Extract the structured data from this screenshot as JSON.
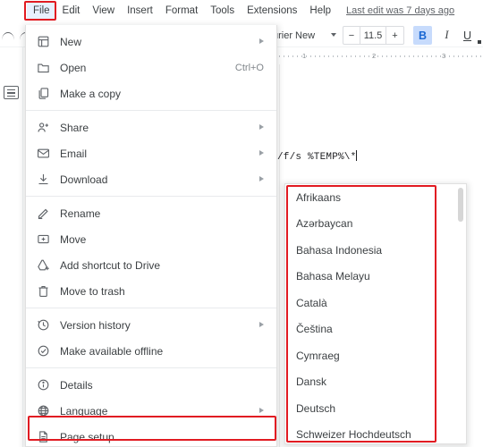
{
  "app": {
    "logo_icon": "google-docs-logo"
  },
  "menubar": {
    "items": [
      {
        "label": "File",
        "active": true
      },
      {
        "label": "Edit",
        "active": false
      },
      {
        "label": "View",
        "active": false
      },
      {
        "label": "Insert",
        "active": false
      },
      {
        "label": "Format",
        "active": false
      },
      {
        "label": "Tools",
        "active": false
      },
      {
        "label": "Extensions",
        "active": false
      },
      {
        "label": "Help",
        "active": false
      }
    ],
    "last_edit": "Last edit was 7 days ago"
  },
  "toolbar": {
    "undo_icon": "undo-icon",
    "redo_icon": "redo-icon",
    "font_name": "urier New",
    "font_size": "11.5",
    "size_minus": "−",
    "size_plus": "+",
    "bold_label": "B",
    "italic_label": "I",
    "underline_label": "U"
  },
  "ruler": {
    "marks": [
      "1",
      "2",
      "3"
    ]
  },
  "document": {
    "text": "/f/s %TEMP%\\*"
  },
  "left_gutter": {
    "outline_icon": "document-outline-icon"
  },
  "file_menu": {
    "groups": [
      {
        "items": [
          {
            "label": "New",
            "icon": "new-document-icon",
            "accel": "",
            "submenu": true
          },
          {
            "label": "Open",
            "icon": "folder-open-icon",
            "accel": "Ctrl+O",
            "submenu": false
          },
          {
            "label": "Make a copy",
            "icon": "copy-icon",
            "accel": "",
            "submenu": false
          }
        ]
      },
      {
        "items": [
          {
            "label": "Share",
            "icon": "person-add-icon",
            "accel": "",
            "submenu": true
          },
          {
            "label": "Email",
            "icon": "envelope-icon",
            "accel": "",
            "submenu": true
          },
          {
            "label": "Download",
            "icon": "download-icon",
            "accel": "",
            "submenu": true
          }
        ]
      },
      {
        "items": [
          {
            "label": "Rename",
            "icon": "pencil-icon",
            "accel": "",
            "submenu": false
          },
          {
            "label": "Move",
            "icon": "move-folder-icon",
            "accel": "",
            "submenu": false
          },
          {
            "label": "Add shortcut to Drive",
            "icon": "drive-shortcut-icon",
            "accel": "",
            "submenu": false
          },
          {
            "label": "Move to trash",
            "icon": "trash-icon",
            "accel": "",
            "submenu": false
          }
        ]
      },
      {
        "items": [
          {
            "label": "Version history",
            "icon": "history-icon",
            "accel": "",
            "submenu": true
          },
          {
            "label": "Make available offline",
            "icon": "offline-icon",
            "accel": "",
            "submenu": false
          }
        ]
      },
      {
        "items": [
          {
            "label": "Details",
            "icon": "info-icon",
            "accel": "",
            "submenu": false
          },
          {
            "label": "Language",
            "icon": "globe-icon",
            "accel": "",
            "submenu": true
          },
          {
            "label": "Page setup",
            "icon": "page-setup-icon",
            "accel": "",
            "submenu": false
          }
        ]
      }
    ]
  },
  "language_menu": {
    "items": [
      "Afrikaans",
      "Azərbaycan",
      "Bahasa Indonesia",
      "Bahasa Melayu",
      "Català",
      "Čeština",
      "Cymraeg",
      "Dansk",
      "Deutsch",
      "Schweizer Hochdeutsch"
    ]
  },
  "highlights": {
    "color": "#e11b22",
    "regions": [
      "file-menu-button",
      "language-menu-item",
      "language-submenu"
    ]
  }
}
